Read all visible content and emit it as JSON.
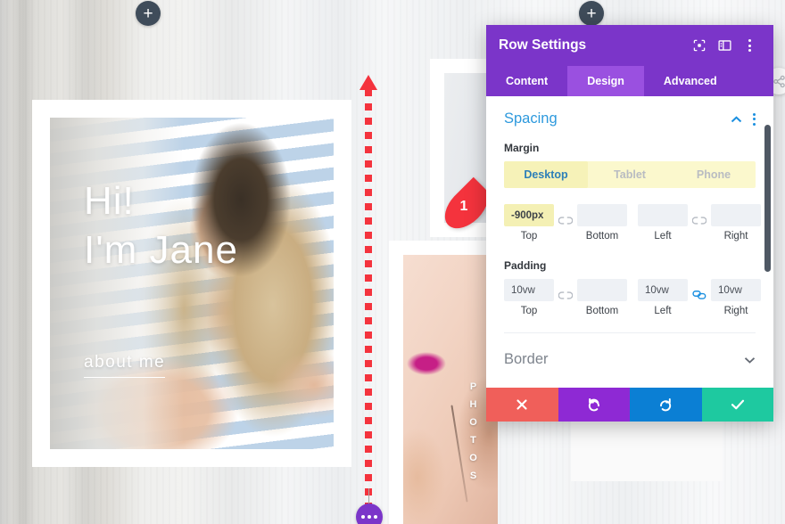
{
  "canvas": {
    "hero": {
      "line1": "Hi!",
      "line2": "I'm Jane",
      "cta": "about me"
    },
    "photos_label": [
      "P",
      "H",
      "O",
      "T",
      "O",
      "S"
    ],
    "add_button_label": "+",
    "pin": {
      "number": "1"
    }
  },
  "panel": {
    "title": "Row Settings",
    "header_icons": {
      "focus": "focus-target-icon",
      "layout": "layout-panel-icon",
      "menu": "more-options-icon"
    },
    "tabs": [
      {
        "label": "Content",
        "active": false
      },
      {
        "label": "Design",
        "active": true
      },
      {
        "label": "Advanced",
        "active": false
      }
    ],
    "section": {
      "title": "Spacing",
      "collapse_icon": "chevron-up-icon",
      "options_icon": "more-options-icon"
    },
    "margin": {
      "label": "Margin",
      "devices": [
        {
          "label": "Desktop",
          "active": true
        },
        {
          "label": "Tablet",
          "active": false
        },
        {
          "label": "Phone",
          "active": false
        }
      ],
      "fields": [
        {
          "caption": "Top",
          "value": "-900px",
          "placeholder": "",
          "highlight": true
        },
        {
          "caption": "Bottom",
          "value": "",
          "placeholder": "",
          "highlight": false
        },
        {
          "caption": "Left",
          "value": "",
          "placeholder": "",
          "highlight": false
        },
        {
          "caption": "Right",
          "value": "",
          "placeholder": "",
          "highlight": false
        }
      ],
      "link_left": "chain-broken-icon",
      "link_right": "chain-broken-icon"
    },
    "padding": {
      "label": "Padding",
      "fields": [
        {
          "caption": "Top",
          "value": "10vw",
          "placeholder": "",
          "highlight": false
        },
        {
          "caption": "Bottom",
          "value": "",
          "placeholder": "",
          "highlight": false
        },
        {
          "caption": "Left",
          "value": "10vw",
          "placeholder": "",
          "highlight": false
        },
        {
          "caption": "Right",
          "value": "10vw",
          "placeholder": "",
          "highlight": false
        }
      ],
      "link_left": "chain-broken-icon",
      "link_right": "chain-linked-icon"
    },
    "border": {
      "title": "Border",
      "expand_icon": "chevron-down-icon"
    },
    "actions": [
      {
        "name": "close",
        "icon": "close-icon",
        "color": "#f05f5a"
      },
      {
        "name": "undo",
        "icon": "undo-icon",
        "color": "#8e29d4"
      },
      {
        "name": "redo",
        "icon": "redo-icon",
        "color": "#0b7fd4"
      },
      {
        "name": "save",
        "icon": "check-icon",
        "color": "#1ec9a0"
      }
    ]
  },
  "colors": {
    "brand_purple": "#7b35c9",
    "tab_active": "#9a50e0",
    "accent_blue": "#2d99dd",
    "highlight_yellow": "#f4f0b4",
    "marker_red": "#f4333d"
  }
}
